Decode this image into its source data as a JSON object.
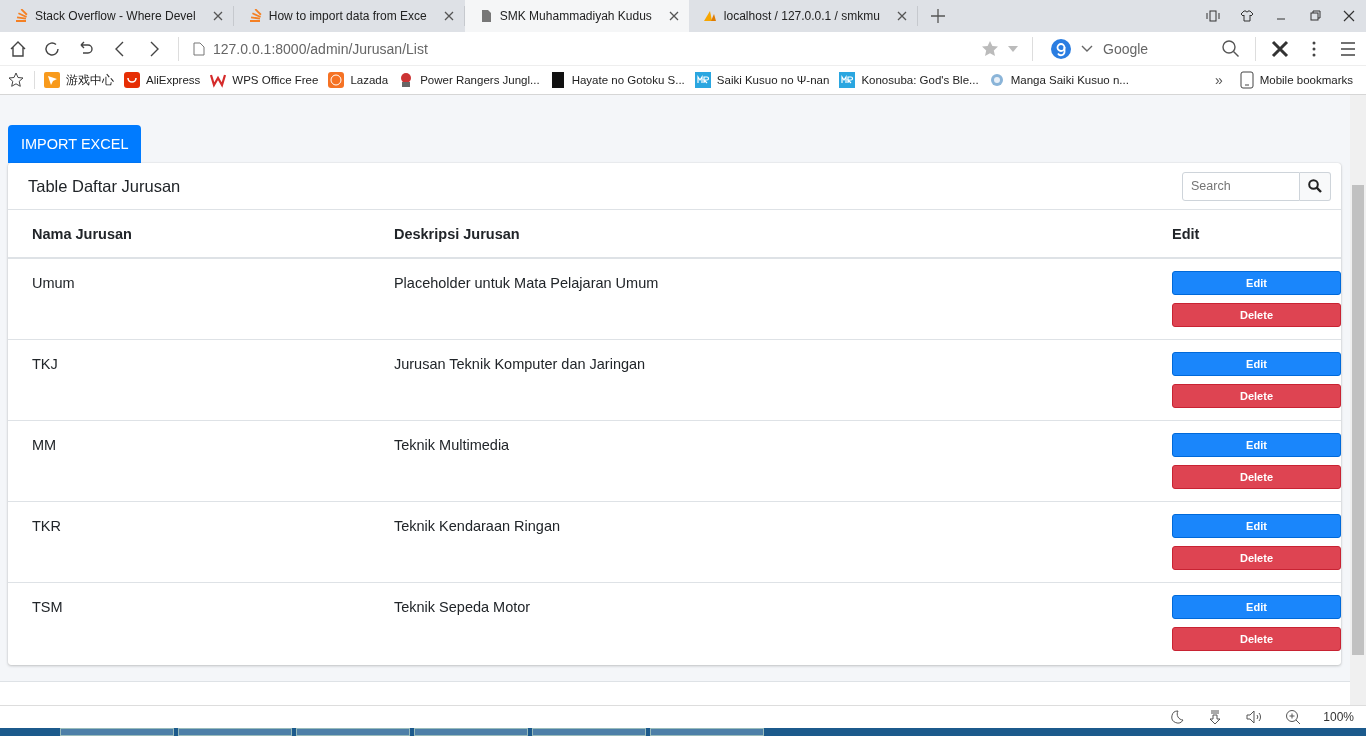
{
  "browser": {
    "tabs": [
      {
        "title": "Stack Overflow - Where Devel",
        "kind": "stack",
        "selected": false
      },
      {
        "title": "How to import data from Exce",
        "kind": "stack",
        "selected": false
      },
      {
        "title": "SMK Muhammadiyah Kudus",
        "kind": "page",
        "selected": true
      },
      {
        "title": "localhost / 127.0.0.1 / smkmu",
        "kind": "pma",
        "selected": false
      }
    ],
    "address": "127.0.0.1:8000/admin/Jurusan/List",
    "search_engine": "Google",
    "bookmarks": [
      {
        "label": "游戏中心",
        "kind": "game"
      },
      {
        "label": "AliExpress",
        "kind": "ali"
      },
      {
        "label": "WPS Office Free",
        "kind": "wps"
      },
      {
        "label": "Lazada",
        "kind": "lazada"
      },
      {
        "label": "Power Rangers Jungl...",
        "kind": "ranger"
      },
      {
        "label": "Hayate no Gotoku S...",
        "kind": "dark"
      },
      {
        "label": "Saiki Kusuo no Ψ-nan",
        "kind": "mr"
      },
      {
        "label": "Konosuba: God's Ble...",
        "kind": "mr"
      },
      {
        "label": "Manga Saiki Kusuo n...",
        "kind": "manga"
      }
    ],
    "more": "»",
    "mobile_bookmarks": "Mobile bookmarks"
  },
  "page": {
    "import_button": "IMPORT EXCEL",
    "card_title": "Table Daftar Jurusan",
    "search": {
      "placeholder": "Search"
    },
    "table": {
      "columns": [
        "Nama Jurusan",
        "Deskripsi Jurusan",
        "Edit"
      ],
      "rows": [
        {
          "nama": "Umum",
          "deskripsi": "Placeholder untuk Mata Pelajaran Umum",
          "edit": "Edit",
          "delete": "Delete"
        },
        {
          "nama": "TKJ",
          "deskripsi": "Jurusan Teknik Komputer dan Jaringan",
          "edit": "Edit",
          "delete": "Delete"
        },
        {
          "nama": "MM",
          "deskripsi": "Teknik Multimedia",
          "edit": "Edit",
          "delete": "Delete"
        },
        {
          "nama": "TKR",
          "deskripsi": "Teknik Kendaraan Ringan",
          "edit": "Edit",
          "delete": "Delete"
        },
        {
          "nama": "TSM",
          "deskripsi": "Teknik Sepeda Motor",
          "edit": "Edit",
          "delete": "Delete"
        }
      ]
    }
  },
  "status_bar": {
    "zoom": "100%"
  }
}
